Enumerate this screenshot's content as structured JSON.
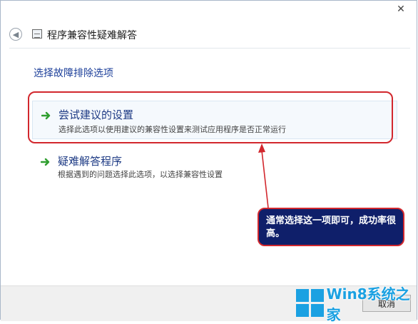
{
  "window": {
    "close_glyph": "✕",
    "title": "程序兼容性疑难解答"
  },
  "main": {
    "heading": "选择故障排除选项",
    "options": [
      {
        "title": "尝试建议的设置",
        "description": "选择此选项以使用建议的兼容性设置来测试应用程序是否正常运行"
      },
      {
        "title": "疑难解答程序",
        "description": "根据遇到的问题选择此选项，以选择兼容性设置"
      }
    ]
  },
  "annotation": {
    "callout_text": "通常选择这一项即可，成功率很高。",
    "color": "#d2272d"
  },
  "footer": {
    "cancel_label": "取消"
  },
  "watermark": {
    "text": "Win8系统之家",
    "color": "#1ba1e2"
  },
  "colors": {
    "arrow_green": "#2f9e2f",
    "link_blue": "#1d3a84",
    "heading_blue": "#1c3f9a"
  }
}
